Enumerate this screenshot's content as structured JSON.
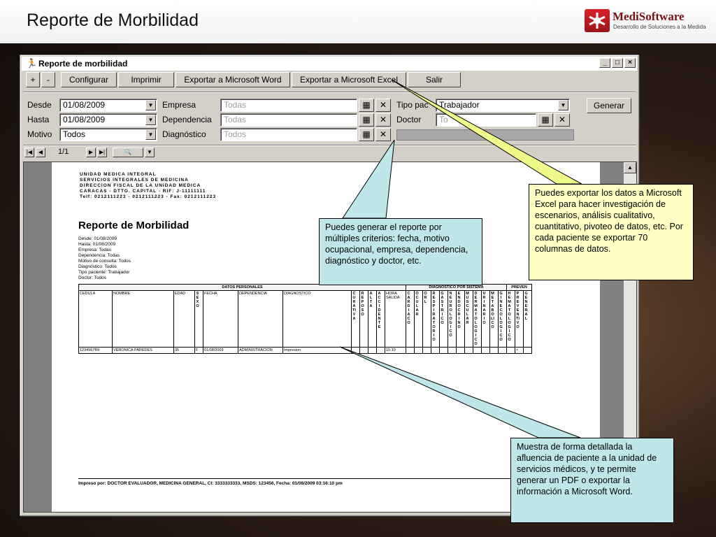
{
  "slide": {
    "title": "Reporte de Morbilidad",
    "logo_name": "MediSoftware",
    "logo_tagline": "Desarrollo de Soluciones a la Medida"
  },
  "window": {
    "title": "Reporte de morbilidad",
    "controls": {
      "minimize": "_",
      "maximize": "□",
      "close": "×"
    }
  },
  "toolbar": {
    "plus": "+",
    "minus": "-",
    "configurar": "Configurar",
    "imprimir": "Imprimir",
    "exportar_word": "Exportar a Microsoft Word",
    "exportar_excel": "Exportar a Microsoft Excel",
    "salir": "Salir"
  },
  "filters": {
    "desde_label": "Desde",
    "desde_value": "01/08/2009",
    "hasta_label": "Hasta",
    "hasta_value": "01/08/2009",
    "motivo_label": "Motivo",
    "motivo_value": "Todos",
    "empresa_label": "Empresa",
    "empresa_value": "Todas",
    "dependencia_label": "Dependencia",
    "dependencia_value": "Todas",
    "diagnostico_label": "Diagnóstico",
    "diagnostico_value": "Todos",
    "tipo_label": "Tipo pac",
    "tipo_value": "Trabajador",
    "doctor_label": "Doctor",
    "doctor_value": "To",
    "generar": "Generar"
  },
  "navigation": {
    "page_indicator": "1/1"
  },
  "report": {
    "org_lines": [
      "UNIDAD MEDICA INTEGRAL",
      "SERVICIOS INTEGRALES DE MEDICINA",
      "DIRECCION FISCAL DE LA UNIDAD MEDICA",
      "CARACAS - DTTO. CAPITAL - RIF: J-11111111",
      "Telf: 0212111223 - 0212111223 - Fax: 0212111223"
    ],
    "title": "Reporte de Morbilidad",
    "criteria_lines": [
      "Desde: 01/08/2009",
      "Hasta: 01/08/2009",
      "Empresa: Todas",
      "Dependencia: Todas",
      "Motivo de consulta: Todos",
      "Diagnóstico: Todos",
      "Tipo paciente: Trabajador",
      "Doctor: Todos"
    ],
    "group_headers": {
      "datos_personales": "DATOS PERSONALES",
      "diagnostico_sistema": "DIAGNOSTICO POR SISTEMA",
      "preven": "PREVEN"
    },
    "columns": [
      "CEDULA",
      "NOMBRE",
      "EDAD",
      "SEXO",
      "FECHA",
      "DEPENDENCIA",
      "DIAGNOSTICO"
    ],
    "motivo_columns": [
      "CURATIVA",
      "REPOSO",
      "ALTA",
      "ACCIDENTE"
    ],
    "hora_column": "HORA SALIDA",
    "sistema_columns": [
      "CARDIACO",
      "OCULAR",
      "ORL",
      "RESPIRATORIO",
      "GASTRICO",
      "NEUROLOGICO",
      "ENDOCRINO",
      "MUSCULAR",
      "DERMATOLOGICO",
      "URINARIO",
      "METABOLICO",
      "GINECOLOGICO"
    ],
    "preven_columns": [
      "HEMATOLOGICO",
      "PREVENTIVO",
      "GENERAL"
    ],
    "row": {
      "cedula": "1234567B9",
      "nombre": "VERONICA PAREDES",
      "edad": "35",
      "sexo": "F",
      "fecha": "01/08/2009",
      "dependencia": "ADMINISTRACION",
      "diagnostico": "Impresion",
      "hora": "15:10",
      "mark": "×"
    },
    "footer": "Impreso por: DOCTOR EVALUADOR, MEDICINA GENERAL, CI: 3333333333, MSDS: 123456, Fecha: 01/08/2009 03:16:10 pm"
  },
  "callouts": {
    "filters": "Puedes generar el reporte por múltiples criterios: fecha, motivo ocupacional, empresa, dependencia, diagnóstico y doctor, etc.",
    "excel": "Puedes exportar los datos a Microsoft Excel para hacer investigación de escenarios, análisis cualitativo, cuantitativo, pivoteo de datos, etc. Por cada paciente se exportar 70 columnas de datos.",
    "detail": "Muestra de forma detallada la afluencia de paciente a la unidad de servicios médicos, y te permite generar un PDF o exportar la información a Microsoft Word."
  }
}
